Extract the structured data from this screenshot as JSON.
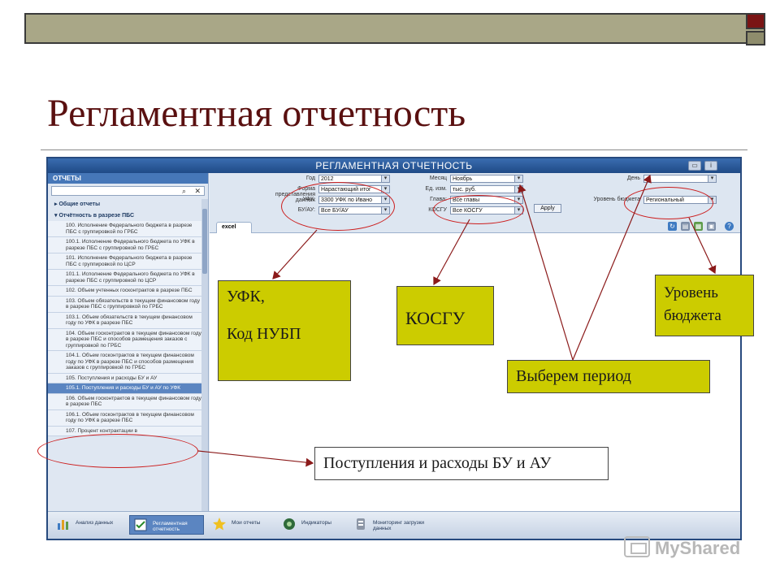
{
  "slide": {
    "title": "Регламентная отчетность"
  },
  "app": {
    "window_title": "РЕГЛАМЕНТНАЯ ОТЧЕТНОСТЬ",
    "sidebar": {
      "header": "ОТЧЕТЫ",
      "groups": [
        "Общие отчеты",
        "Отчётность в разрезе ПБС"
      ],
      "items": [
        "100. Исполнение Федерального бюджета в разрезе ПБС с группировкой по ГРБС",
        "100.1. Исполнение Федерального бюджета по УФК в разрезе ПБС с группировкой по ГРБС",
        "101. Исполнение Федерального бюджета в разрезе ПБС с группировкой по ЦСР",
        "101.1. Исполнение Федерального бюджета по УФК в разрезе ПБС с группировкой по ЦСР",
        "102. Объем учтенных госконтрактов в разрезе ПБС",
        "103. Объем обязательств в текущем финансовом году в разрезе ПБС с группировкой по ГРБС",
        "103.1. Объем обязательств в текущем финансовом году по УФК в разрезе ПБС",
        "104. Объем госконтрактов в текущем финансовом году в разрезе ПБС и способов размещения заказов с группировкой по ГРБС",
        "104.1. Объем госконтрактов в текущем финансовом году по УФК в разрезе ПБС и способов размещения заказов с группировкой по ГРБС",
        "105. Поступления и расходы БУ и АУ",
        "105.1. Поступления и расходы БУ и АУ по УФК",
        "106. Объем госконтрактов в текущем финансовом году в разрезе ПБС",
        "106.1. Объем госконтрактов в текущем финансовом году по УФК в разрезе ПБС",
        "107. Процент контрактации в"
      ],
      "active_index": 10
    },
    "filters": {
      "god_label": "Год",
      "god_value": "2012",
      "forma_label": "Форма представления данных",
      "forma_value": "Нарастающий итог",
      "ufk_label": "УФК:",
      "ufk_value": "3300 УФК по Ивано",
      "buau_label": "БУ/АУ:",
      "buau_value": "Все БУ/АУ",
      "mesyac_label": "Месяц",
      "mesyac_value": "Ноябрь",
      "ed_label": "Ед. изм.",
      "ed_value": "тыс. руб.",
      "glava_label": "Глава:",
      "glava_value": "Все главы",
      "kosgu_label": "КОСГУ",
      "kosgu_value": "Все КОСГУ",
      "den_label": "День",
      "den_value": "",
      "uroven_label": "Уровень бюджета",
      "uroven_value": "Региональный",
      "apply_label": "Apply"
    },
    "tab": "excel",
    "taskbar": [
      "Анализ данных",
      "Регламентная отчетность",
      "Мои отчеты",
      "Индикаторы",
      "Мониторинг загрузки данных"
    ]
  },
  "callouts": {
    "ufk": "УФК,\n\nКод НУБП",
    "kosgu": "КОСГУ",
    "uroven": "Уровень бюджета",
    "period": "Выберем период",
    "postupleniya": "Поступления и расходы БУ и АУ"
  },
  "brand": {
    "name": "MyShared"
  },
  "colors": {
    "callout": "#cccc00",
    "arrow": "#8b1a1a",
    "ellipse": "#cc1e1e"
  }
}
